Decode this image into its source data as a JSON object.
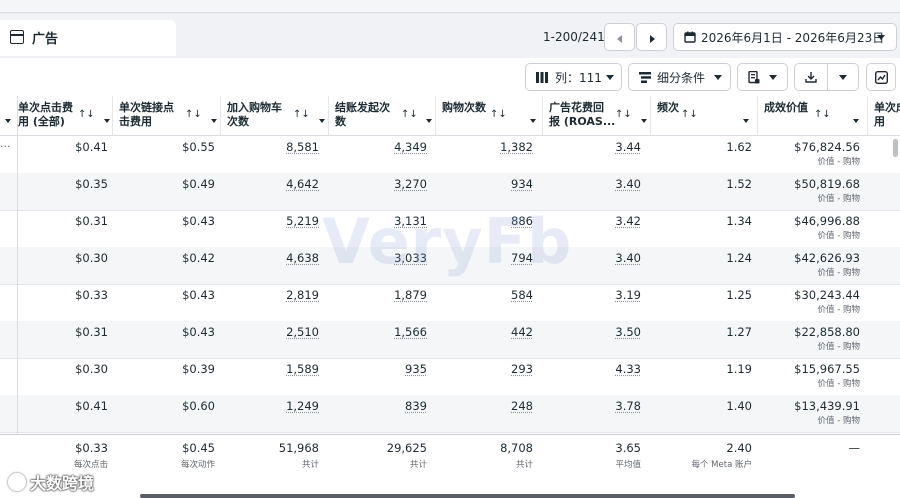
{
  "header": {
    "title": "广告",
    "pager": "1-200/241",
    "date_range": "2026年6月1日 - 2026年6月23日"
  },
  "toolbar": {
    "columns_label": "列：111",
    "breakdown_label": "细分条件"
  },
  "columns": [
    {
      "key": "cpc_all",
      "label_line1": "单次点击费",
      "label_line2": "用 (全部)"
    },
    {
      "key": "cpc_link",
      "label_line1": "单次链接点",
      "label_line2": "击费用"
    },
    {
      "key": "atc",
      "label_line1": "加入购物车",
      "label_line2": "次数"
    },
    {
      "key": "checkout",
      "label_line1": "结账发起次",
      "label_line2": "数"
    },
    {
      "key": "purchases",
      "label_line1": "购物次数",
      "label_line2": ""
    },
    {
      "key": "roas",
      "label_line1": "广告花费回",
      "label_line2": "报 (ROAS..."
    },
    {
      "key": "freq",
      "label_line1": "频次",
      "label_line2": ""
    },
    {
      "key": "conv_value",
      "label_line1": "成效价值",
      "label_line2": ""
    },
    {
      "key": "cut",
      "label_line1": "单次成",
      "label_line2": "用"
    }
  ],
  "sort_icon": "↑↓",
  "first_row_overflow": "...",
  "rows": [
    {
      "cpc_all": "$0.41",
      "cpc_link": "$0.55",
      "atc": "8,581",
      "checkout": "4,349",
      "purchases": "1,382",
      "roas": "3.44",
      "freq": "1.62",
      "conv_value": "$76,824.56",
      "conv_sub": "价值 - 购物"
    },
    {
      "cpc_all": "$0.35",
      "cpc_link": "$0.49",
      "atc": "4,642",
      "checkout": "3,270",
      "purchases": "934",
      "roas": "3.40",
      "freq": "1.52",
      "conv_value": "$50,819.68",
      "conv_sub": "价值 - 购物"
    },
    {
      "cpc_all": "$0.31",
      "cpc_link": "$0.43",
      "atc": "5,219",
      "checkout": "3,131",
      "purchases": "886",
      "roas": "3.42",
      "freq": "1.34",
      "conv_value": "$46,996.88",
      "conv_sub": "价值 - 购物"
    },
    {
      "cpc_all": "$0.30",
      "cpc_link": "$0.42",
      "atc": "4,638",
      "checkout": "3,033",
      "purchases": "794",
      "roas": "3.40",
      "freq": "1.24",
      "conv_value": "$42,626.93",
      "conv_sub": "价值 - 购物"
    },
    {
      "cpc_all": "$0.33",
      "cpc_link": "$0.43",
      "atc": "2,819",
      "checkout": "1,879",
      "purchases": "584",
      "roas": "3.19",
      "freq": "1.25",
      "conv_value": "$30,243.44",
      "conv_sub": "价值 - 购物"
    },
    {
      "cpc_all": "$0.31",
      "cpc_link": "$0.43",
      "atc": "2,510",
      "checkout": "1,566",
      "purchases": "442",
      "roas": "3.50",
      "freq": "1.27",
      "conv_value": "$22,858.80",
      "conv_sub": "价值 - 购物"
    },
    {
      "cpc_all": "$0.30",
      "cpc_link": "$0.39",
      "atc": "1,589",
      "checkout": "935",
      "purchases": "293",
      "roas": "4.33",
      "freq": "1.19",
      "conv_value": "$15,967.55",
      "conv_sub": "价值 - 购物"
    },
    {
      "cpc_all": "$0.41",
      "cpc_link": "$0.60",
      "atc": "1,249",
      "checkout": "839",
      "purchases": "248",
      "roas": "3.78",
      "freq": "1.40",
      "conv_value": "$13,439.91",
      "conv_sub": "价值 - 购物"
    }
  ],
  "totals": {
    "cpc_all": "$0.33",
    "cpc_all_sub": "每次点击",
    "cpc_link": "$0.45",
    "cpc_link_sub": "每次动作",
    "atc": "51,968",
    "atc_sub": "共计",
    "checkout": "29,625",
    "checkout_sub": "共计",
    "purchases": "8,708",
    "purchases_sub": "共计",
    "roas": "3.65",
    "roas_sub": "平均值",
    "freq": "2.40",
    "freq_sub": "每个 Meta 账户",
    "conv_value": "—"
  },
  "watermark": "VeryFb",
  "corner_logo": "大数跨境",
  "icons": [
    "table-icon",
    "chevron-left-icon",
    "chevron-right-icon",
    "calendar-icon",
    "columns-icon",
    "breakdown-icon",
    "reports-icon",
    "download-icon",
    "chart-icon",
    "sort-icon",
    "dropdown-icon"
  ]
}
